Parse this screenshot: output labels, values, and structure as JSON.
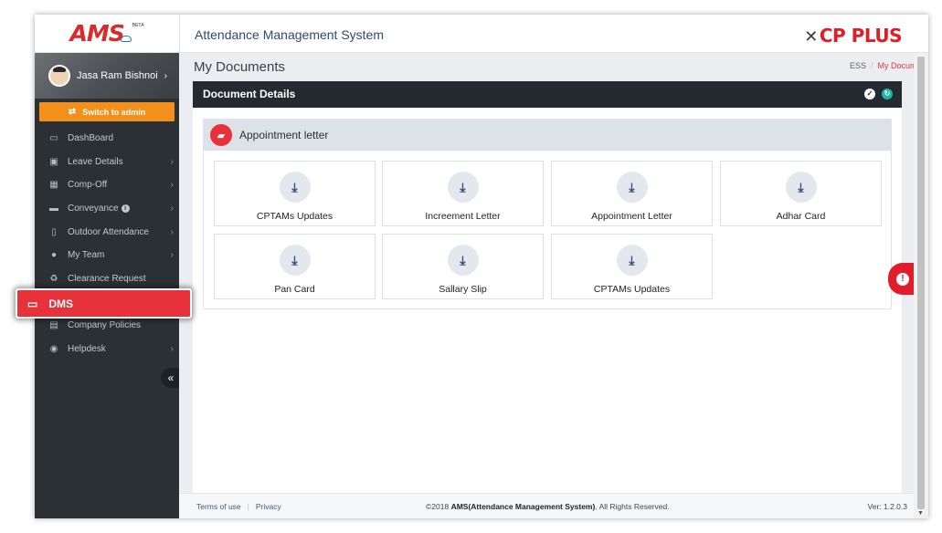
{
  "sidebar": {
    "logo": "AMS",
    "logo_beta": "BETA",
    "user_name": "Jasa Ram Bishnoi",
    "switch_label": "Switch to admin",
    "items": [
      {
        "label": "DashBoard",
        "icon": "laptop-icon"
      },
      {
        "label": "Leave Details",
        "icon": "calendar-icon"
      },
      {
        "label": "Comp-Off",
        "icon": "calendar-grid-icon"
      },
      {
        "label": "Conveyance",
        "icon": "car-icon"
      },
      {
        "label": "Outdoor Attendance",
        "icon": "mobile-icon"
      },
      {
        "label": "My Team",
        "icon": "users-icon"
      },
      {
        "label": "Clearance Request",
        "icon": "recycle-icon"
      },
      {
        "label": "DMS",
        "icon": "laptop-icon"
      },
      {
        "label": "Company Policies",
        "icon": "document-icon"
      },
      {
        "label": "Helpdesk",
        "icon": "eye-icon"
      }
    ]
  },
  "header": {
    "app_title": "Attendance Management System",
    "brand": "CP PLUS"
  },
  "page": {
    "title": "My Documents",
    "breadcrumb": [
      "ESS",
      "My Document"
    ]
  },
  "panel": {
    "title": "Document Details"
  },
  "folder": {
    "title": "Appointment letter",
    "documents": [
      "CPTAMs Updates",
      "Increement Letter",
      "Appointment Letter",
      "Adhar Card",
      "Pan Card",
      "Sallary Slip",
      "CPTAMs Updates"
    ]
  },
  "footer": {
    "terms": "Terms of use",
    "privacy": "Privacy",
    "copyright_prefix": "©2018",
    "copyright_name": "AMS(Attendance Management System)",
    "copyright_suffix": ". All Rights Reserved.",
    "version": "Ver: 1.2.0.3"
  },
  "colors": {
    "accent_red": "#e7323b",
    "switch_orange": "#f3901b",
    "sidebar_bg": "#2b3035",
    "header_title": "#2f4a6d"
  }
}
